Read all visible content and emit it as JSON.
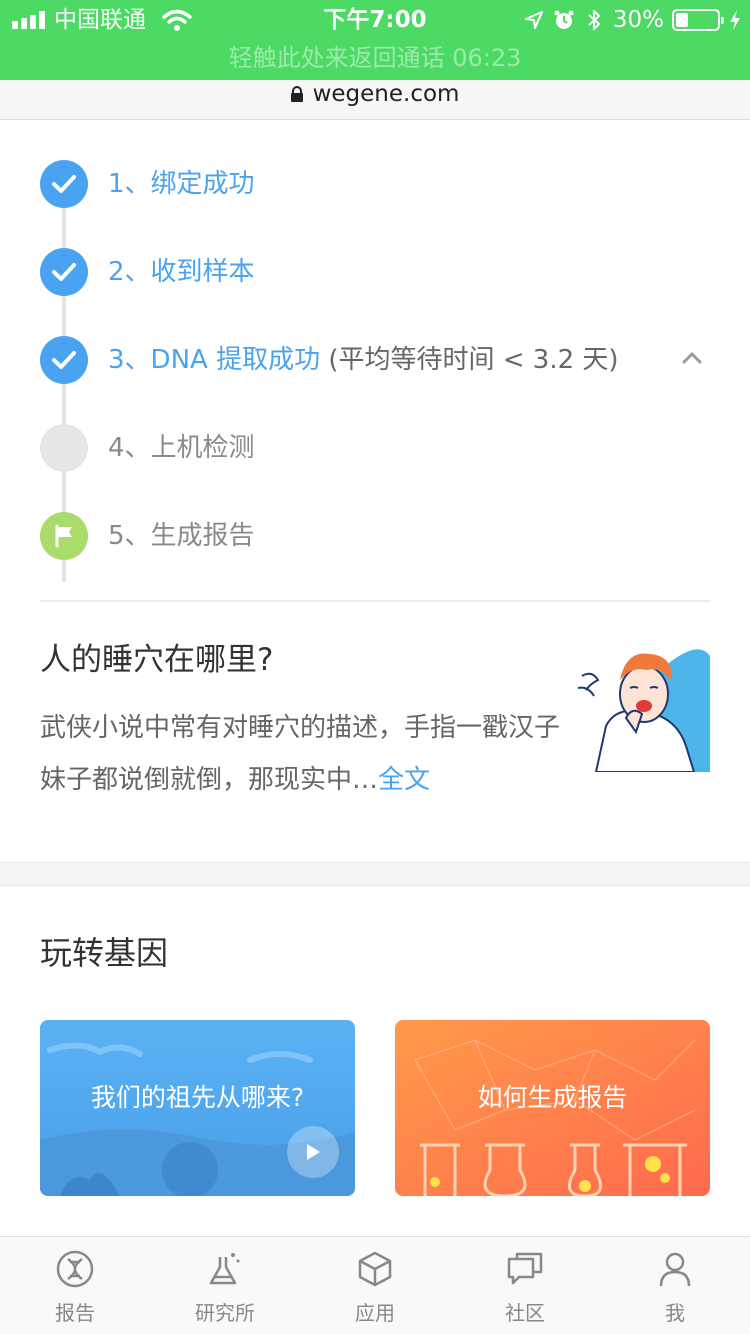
{
  "status_bar": {
    "carrier": "中国联通",
    "time": "下午7:00",
    "battery": "30%",
    "battery_level": 0.3,
    "call_banner": "轻触此处来返回通话 06:23",
    "color": "#4cd964"
  },
  "browser": {
    "url": "wegene.com"
  },
  "steps": [
    {
      "label": "1、绑定成功",
      "extra": "",
      "state": "done"
    },
    {
      "label": "2、收到样本",
      "extra": "",
      "state": "done"
    },
    {
      "label": "3、DNA 提取成功",
      "extra": " (平均等待时间 < 3.2 天)",
      "state": "done"
    },
    {
      "label": "4、上机检测",
      "extra": "",
      "state": "pending"
    },
    {
      "label": "5、生成报告",
      "extra": "",
      "state": "flag"
    }
  ],
  "article": {
    "title": "人的睡穴在哪里?",
    "body": "武侠小说中常有对睡穴的描述，手指一戳汉子妹子都说倒就倒，那现实中…",
    "more": "全文"
  },
  "section": {
    "title": "玩转基因"
  },
  "cards": [
    {
      "label": "我们的祖先从哪来?",
      "icon": "play-icon"
    },
    {
      "label": "如何生成报告"
    }
  ],
  "tabs": [
    {
      "label": "报告",
      "icon": "dna-icon"
    },
    {
      "label": "研究所",
      "icon": "flask-icon"
    },
    {
      "label": "应用",
      "icon": "cube-icon"
    },
    {
      "label": "社区",
      "icon": "chat-icon"
    },
    {
      "label": "我",
      "icon": "person-icon"
    }
  ],
  "colors": {
    "accent": "#4aa3f0",
    "pending": "#e6e6e6",
    "flag": "#a9dc6a",
    "text": "#333333",
    "muted": "#888888"
  }
}
